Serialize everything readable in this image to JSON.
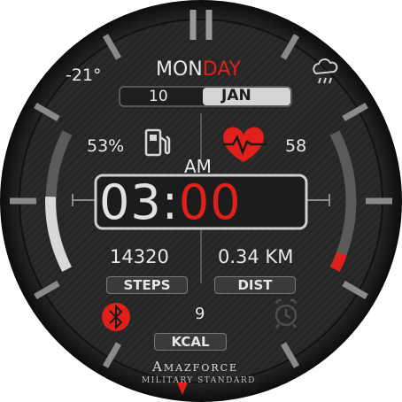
{
  "weather": {
    "temperature": "-21°",
    "icon": "cloud-rain-icon"
  },
  "date": {
    "day_prefix": "MON",
    "day_suffix": "DAY",
    "day_number": "10",
    "month": "JAN"
  },
  "battery": {
    "percent": "53%",
    "icon": "fuel-pump-icon",
    "level_fraction": 0.53
  },
  "heart_rate": {
    "value": "58",
    "icon": "heart-rate-icon",
    "level_fraction": 0.12
  },
  "time": {
    "ampm": "AM",
    "hours": "03",
    "separator": ":",
    "minutes": "00"
  },
  "steps": {
    "value": "14320",
    "label": "STEPS"
  },
  "distance": {
    "value": "0.34 KM",
    "label": "DIST"
  },
  "calories": {
    "value": "9",
    "label": "KCAL"
  },
  "status": {
    "bluetooth_icon": "bluetooth-icon",
    "alarm_icon": "alarm-clock-icon"
  },
  "brand": {
    "name": "Amazforce",
    "tagline": "MILITARY STANDARD"
  },
  "colors": {
    "accent": "#e0201a",
    "text": "#e8e8e8",
    "bezel": "#1e1e1e",
    "face": "#2a2a2a"
  }
}
